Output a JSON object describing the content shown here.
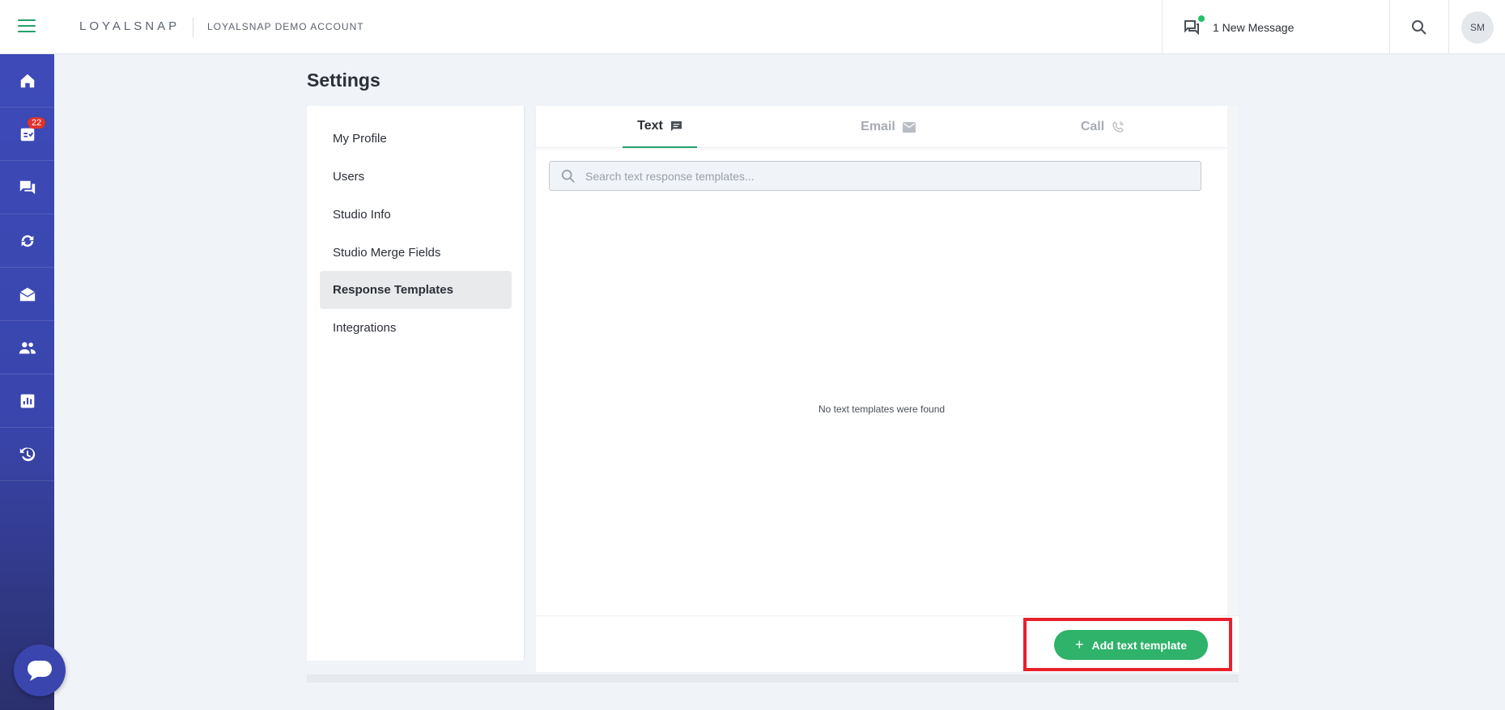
{
  "header": {
    "brand": "LOYALSNAP",
    "account": "LOYALSNAP DEMO ACCOUNT",
    "new_message": "1 New Message",
    "avatar_initials": "SM"
  },
  "sidenav": {
    "inbox_badge": "22",
    "items": [
      "home-icon",
      "tasks-icon",
      "conversations-icon",
      "sync-icon",
      "mail-icon",
      "contacts-icon",
      "reports-icon",
      "history-icon"
    ]
  },
  "page": {
    "title": "Settings"
  },
  "settings_menu": {
    "items": [
      {
        "label": "My Profile"
      },
      {
        "label": "Users"
      },
      {
        "label": "Studio Info"
      },
      {
        "label": "Studio Merge Fields"
      },
      {
        "label": "Response Templates"
      },
      {
        "label": "Integrations"
      }
    ],
    "active": "Response Templates"
  },
  "tabs": [
    {
      "label": "Text"
    },
    {
      "label": "Email"
    },
    {
      "label": "Call"
    }
  ],
  "search": {
    "placeholder": "Search text response templates..."
  },
  "empty_state": "No text templates were found",
  "footer": {
    "add_button_label": "Add text template"
  },
  "colors": {
    "accent_green": "#2fb26a",
    "nav_blue": "#3d4ab8",
    "highlight_red": "#e8202b",
    "badge_red": "#e0322b"
  }
}
